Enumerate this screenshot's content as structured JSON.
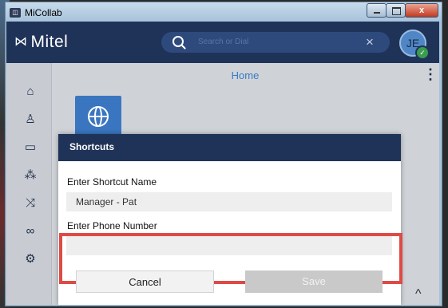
{
  "window": {
    "title": "MiCollab",
    "close_glyph": "x"
  },
  "header": {
    "brand": "Mitel",
    "search": {
      "placeholder": "Search or Dial",
      "clear_glyph": "×"
    },
    "avatar": {
      "initials": "JE",
      "status_glyph": "✓",
      "status_color": "#3a9d4e"
    }
  },
  "sidebar": {
    "items": [
      {
        "name": "home",
        "icon": "home-icon",
        "glyph": "⌂"
      },
      {
        "name": "contacts",
        "icon": "person-icon",
        "glyph": "♙"
      },
      {
        "name": "chat",
        "icon": "chat-icon",
        "glyph": "▭"
      },
      {
        "name": "groups",
        "icon": "groups-icon",
        "glyph": "⁂"
      },
      {
        "name": "calls",
        "icon": "call-history-icon",
        "glyph": "⤨"
      },
      {
        "name": "voicemail",
        "icon": "voicemail-icon",
        "glyph": "∞"
      },
      {
        "name": "settings",
        "icon": "gear-icon",
        "glyph": "⚙"
      }
    ]
  },
  "main": {
    "title": "Home",
    "menu_glyph": "⋮",
    "tile_icon": "globe-icon"
  },
  "dialog": {
    "title": "Shortcuts",
    "name_label": "Enter Shortcut Name",
    "name_value": "Manager - Pat",
    "phone_label": "Enter Phone Number",
    "phone_value": "",
    "cancel_label": "Cancel",
    "save_label": "Save"
  },
  "scroll": {
    "up_glyph": "^"
  },
  "colors": {
    "brand": "#1f3358",
    "accent": "#3b79c2",
    "highlight": "#de4a45"
  }
}
